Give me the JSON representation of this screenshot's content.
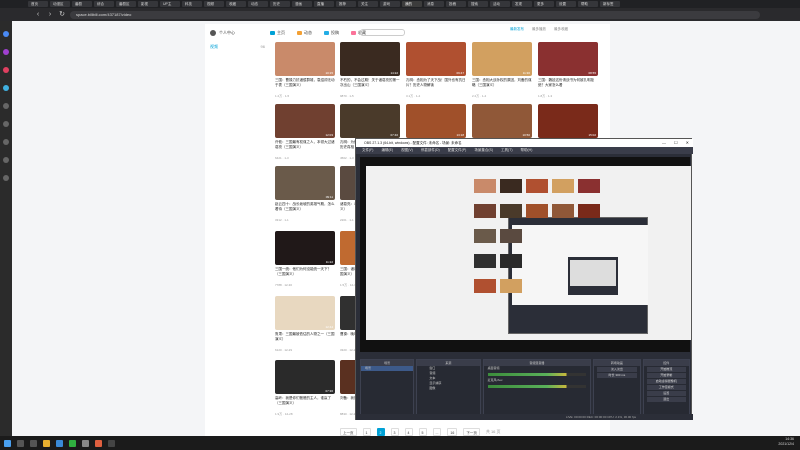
{
  "browser": {
    "logo": "三国",
    "tabs": [
      "首页",
      "动漫区",
      "番剧",
      "综合",
      "番剧区",
      "影视",
      "UP主",
      "科技",
      "视频",
      "收藏",
      "动态",
      "历史",
      "漫画",
      "直播",
      "推荐",
      "关注",
      "游戏",
      "我的",
      "消息",
      "投稿",
      "搜索",
      "活动",
      "发现",
      "更多",
      "设置",
      "帮助",
      "新标签"
    ],
    "url": "space.bilibili.com/437187/video"
  },
  "sidebar": {
    "header": "个人中心"
  },
  "nav": {
    "tabs": [
      {
        "label": "主页",
        "color": "#00a1d6"
      },
      {
        "label": "动态",
        "color": "#f3a034"
      },
      {
        "label": "投稿",
        "color": "#23ade5"
      },
      {
        "label": "收藏",
        "color": "#fb7299"
      }
    ]
  },
  "sort": [
    "最新发布",
    "最多播放",
    "最多收藏"
  ],
  "leftmenu": {
    "label": "视频",
    "count": "96"
  },
  "cards": [
    {
      "title": "三国：曹操力抗诸侯群雄，袁绍却无动于衷（三国演义）",
      "meta": "1.2万 · 1-5",
      "dur": "10:15",
      "color": "#c98a6a"
    },
    {
      "title": "不朽的，不会过期！关于诸葛亮的第一次出山（三国演义）",
      "meta": "9870 · 1-5",
      "dur": "14:22",
      "color": "#3a2a20"
    },
    {
      "title": "孔明：丞相为了天下战！国外也有抗日片？历史人物解读",
      "meta": "3.1万 · 1-4",
      "dur": "09:47",
      "color": "#b05030"
    },
    {
      "title": "三国：丞相大战孙权的原因，刘备的谋略（三国演义）",
      "meta": "2.2万 · 1-4",
      "dur": "11:30",
      "color": "#d2a060"
    },
    {
      "title": "三国：魏延这份请战书为何被孔明拒绝？大家怎么看",
      "meta": "1.8万 · 1-3",
      "dur": "08:55",
      "color": "#8a3030"
    },
    {
      "title": "许攸：三国最有权谋之人，本领大过诸葛亮（三国演义）",
      "meta": "6421 · 1-3",
      "dur": "12:03",
      "color": "#704030"
    },
    {
      "title": "孔明：为什么诸葛亮做不到七擒孟获？历史真相",
      "meta": "4502 · 1-3",
      "dur": "07:40",
      "color": "#4a3a2a"
    },
    {
      "title": "三国：丞相，诸葛亮的北伐计划到底输在哪里（三国演义）",
      "meta": "5230 · 1-2",
      "dur": "13:18",
      "color": "#a0502a"
    },
    {
      "title": "三国：刘备与曹操之间的关系是怎样的（三国演义）",
      "meta": "1.1万 · 1-2",
      "dur": "10:50",
      "color": "#905838"
    },
    {
      "title": "三国：关羽为何败走麦城？真正原因（三国演义）",
      "meta": "2.4万 · 1-2",
      "dur": "15:02",
      "color": "#7a2a1a"
    },
    {
      "title": "赵云四十：战长坂坡的英雄气概，怎么看待（三国演义）",
      "meta": "3312 · 1-1",
      "dur": "09:11",
      "color": "#6a5a4a"
    },
    {
      "title": "诸葛亮：老谋深算，要不要（三国演义）",
      "meta": "2201 · 1-1",
      "dur": "08:30",
      "color": "#5a4a40"
    },
    {
      "title": "三国一统：他们为何没能统一天下？（三国演义）",
      "meta": "7788 · 12-30",
      "dur": "11:22",
      "color": "#201818"
    },
    {
      "title": "三国：诸葛亮的大局观，你怎么看（三国演义）",
      "meta": "1.5万 · 12-30",
      "dur": "10:05",
      "color": "#c06a30"
    },
    {
      "title": "鲁肃：三国最被低估的人物之一（三国演义）",
      "meta": "6120 · 12-29",
      "dur": "12:44",
      "color": "#e8d8c0"
    },
    {
      "title": "曹操：晚年的抉择与遗憾（三国演义）",
      "meta": "3320 · 12-29",
      "dur": "09:58",
      "color": "#303030"
    },
    {
      "title": "高岭：我是你们爸爸的主人，谁赢了（三国演义）",
      "meta": "1.9万 · 12-28",
      "dur": "07:36",
      "color": "#2a2a2a"
    },
    {
      "title": "刘备：我是你们皇帝（三国演义）",
      "meta": "8830 · 12-28",
      "dur": "11:11",
      "color": "#5a3020"
    }
  ],
  "pager": {
    "prev": "上一页",
    "pages": [
      "1",
      "2",
      "3",
      "4",
      "5",
      "...",
      "16"
    ],
    "current": "2",
    "next": "下一页",
    "total": "共 16 页"
  },
  "obs": {
    "title": "OBS 27.1.3 (64-bit, windows) - 配置文件: 未命名 - 场景: 未命名",
    "controls": [
      "—",
      "☐",
      "✕"
    ],
    "menu": [
      "文件(F)",
      "编辑(E)",
      "视图(V)",
      "停靠部件(D)",
      "配置文件(P)",
      "场景集合(S)",
      "工具(T)",
      "帮助(H)"
    ],
    "docks": [
      "场景",
      "来源",
      "音频混音器",
      "转场动画",
      "控件"
    ],
    "scene": "场景",
    "sources": [
      "窗口",
      "音频",
      "文本",
      "显示捕获",
      "图像"
    ],
    "mixer": [
      "桌面音频",
      "麦克风/Aux"
    ],
    "transition": [
      "淡入淡出",
      "时长 300 ms"
    ],
    "buttons": [
      "开始推流",
      "开始录制",
      "启动虚拟摄像机",
      "工作室模式",
      "设置",
      "退出"
    ],
    "status": "LIVE: 00:00:00   REC: 00:00:00   CPU: 2.1%, 30.00 fps"
  },
  "taskbar": {
    "time": "14:36",
    "date": "2021/12/4"
  }
}
